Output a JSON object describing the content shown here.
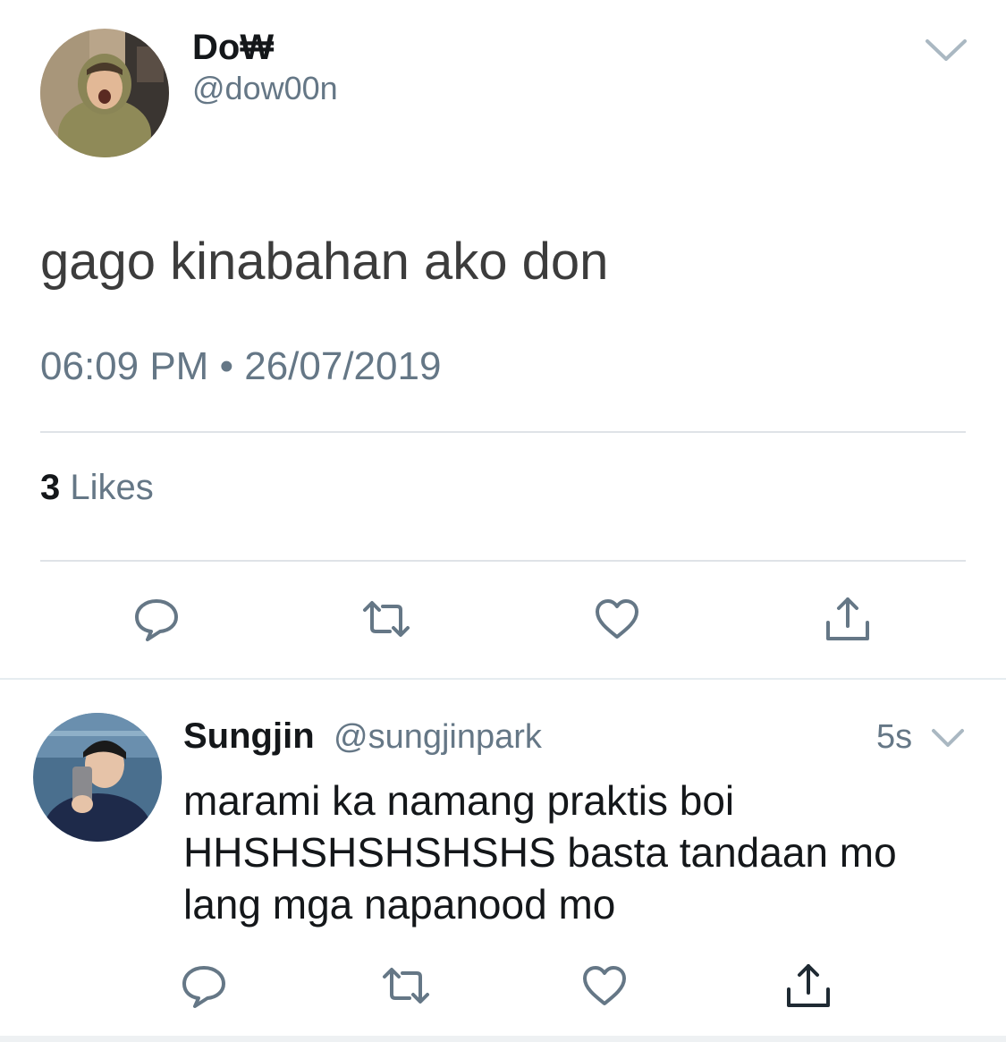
{
  "tweet": {
    "author_name": "Do₩",
    "author_handle": "@dow00n",
    "text": "gago kinabahan ako don",
    "time": "06:09 PM",
    "separator": "•",
    "date": "26/07/2019",
    "likes_count": "3",
    "likes_label": "Likes",
    "actions": [
      "reply-icon",
      "retweet-icon",
      "like-icon",
      "share-icon"
    ]
  },
  "reply": {
    "author_name": "Sungjin",
    "author_handle": "@sungjinpark",
    "time_ago": "5s",
    "text": "marami ka namang praktis boi HHSHSHSHSHSHS basta tandaan mo lang mga napanood mo",
    "actions": [
      "reply-icon",
      "retweet-icon",
      "like-icon",
      "share-icon"
    ]
  },
  "colors": {
    "text_primary": "#14171a",
    "text_secondary": "#657786",
    "icon": "#657786",
    "divider": "#dfe3e7"
  }
}
